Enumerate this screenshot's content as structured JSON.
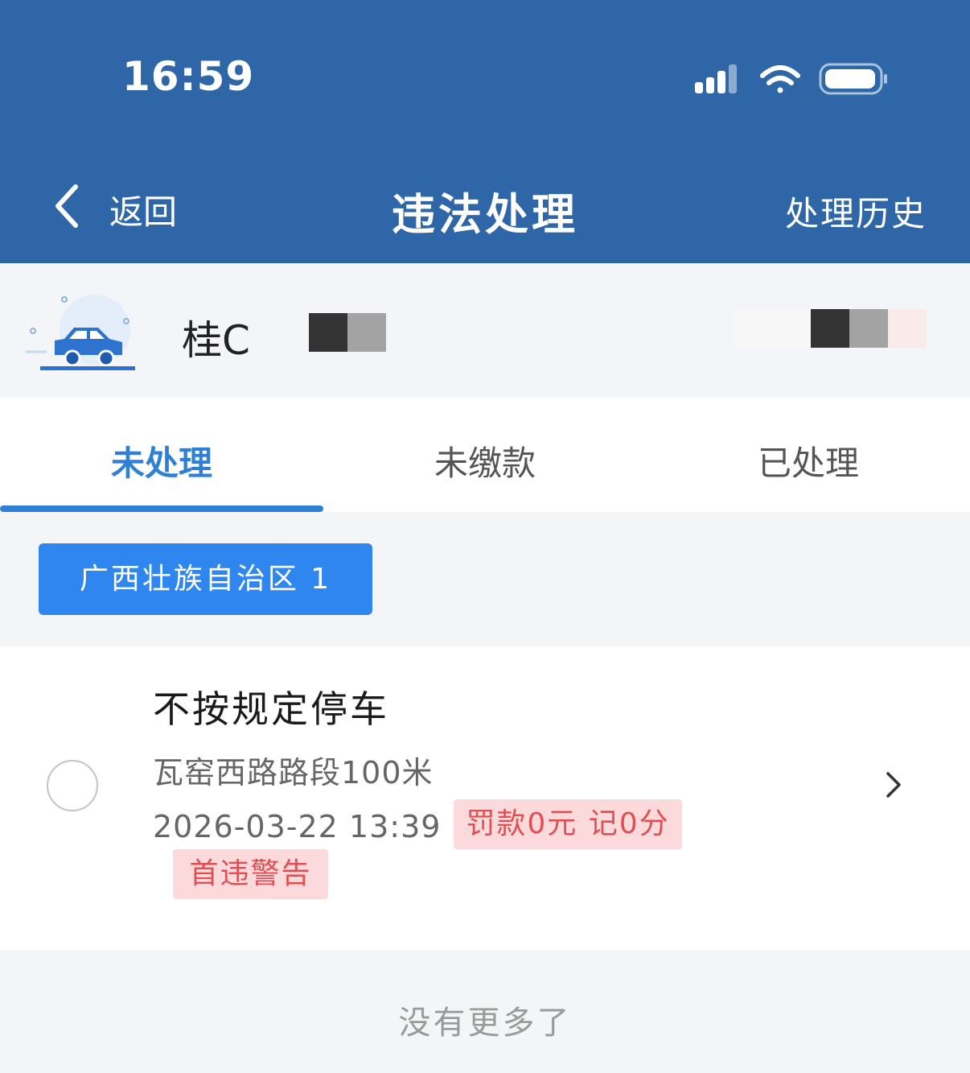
{
  "status_bar": {
    "time": "16:59"
  },
  "nav": {
    "back_label": "返回",
    "title": "违法处理",
    "history_label": "处理历史"
  },
  "vehicle": {
    "plate": "桂C"
  },
  "tabs": [
    {
      "label": "未处理",
      "active": true
    },
    {
      "label": "未缴款",
      "active": false
    },
    {
      "label": "已处理",
      "active": false
    }
  ],
  "region": {
    "label": "广西壮族自治区 1"
  },
  "violation": {
    "title": "不按规定停车",
    "location": "瓦窑西路路段100米",
    "datetime": "2026-03-22 13:39",
    "fine_tag": "罚款0元 记0分",
    "warning_tag": "首违警告"
  },
  "footer": {
    "text": "没有更多了"
  },
  "colors": {
    "header_bg": "#2e66a8",
    "accent": "#2e7fd6",
    "button_bg": "#2f86ef",
    "tag_bg": "#fcd9da",
    "tag_text": "#e04f52"
  }
}
